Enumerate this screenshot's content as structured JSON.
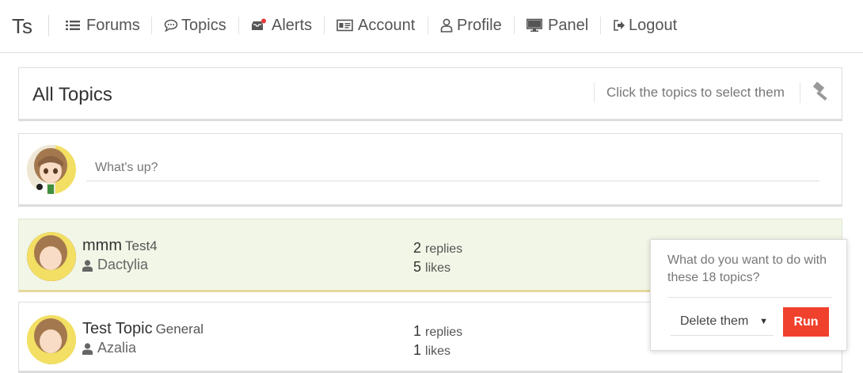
{
  "nav": {
    "brand": "Ts",
    "items": [
      {
        "label": "Forums",
        "icon": "list-icon"
      },
      {
        "label": "Topics",
        "icon": "comment-icon"
      },
      {
        "label": "Alerts",
        "icon": "inbox-alert-icon"
      },
      {
        "label": "Account",
        "icon": "id-card-icon"
      },
      {
        "label": "Profile",
        "icon": "user-icon"
      },
      {
        "label": "Panel",
        "icon": "desktop-icon"
      },
      {
        "label": "Logout",
        "icon": "sign-out-icon"
      }
    ]
  },
  "header": {
    "title": "All Topics",
    "hint": "Click the topics to select them",
    "mod_icon": "gavel-icon"
  },
  "compose": {
    "placeholder": "What's up?"
  },
  "topics": [
    {
      "title": "mmm",
      "forum": "Test4",
      "author": "Dactylia",
      "replies": "2",
      "replies_label": "replies",
      "likes": "5",
      "likes_label": "likes",
      "selected": true
    },
    {
      "title": "Test Topic",
      "forum": "General",
      "author": "Azalia",
      "replies": "1",
      "replies_label": "replies",
      "likes": "1",
      "likes_label": "likes",
      "selected": false
    }
  ],
  "mod_popup": {
    "question": "What do you want to do with these 18 topics?",
    "action_selected": "Delete them",
    "run_label": "Run"
  },
  "colors": {
    "selected_row_bg": "#f1f6e6",
    "run_button": "#f0412c",
    "alert_dot": "#e53935"
  }
}
